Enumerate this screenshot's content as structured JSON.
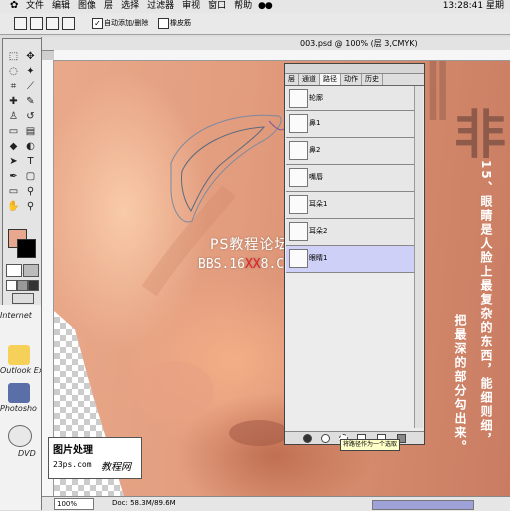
{
  "menubar": {
    "items": [
      "文件",
      "编辑",
      "图像",
      "层",
      "选择",
      "过滤器",
      "审视",
      "窗口",
      "帮助"
    ],
    "clock": "13:28:41 星期"
  },
  "options": {
    "auto_add_label": "自动添加/删除",
    "rubber_band_label": "橡皮筋"
  },
  "document": {
    "title": "003.psd @ 100% (层 3,CMYK)",
    "zoom": "100%",
    "doc_info": "Doc: 58.3M/89.6M"
  },
  "paths_panel": {
    "tabs": [
      "层",
      "通道",
      "路径",
      "动作",
      "历史"
    ],
    "active_tab": "路径",
    "rows": [
      "轮廓",
      "鼻1",
      "鼻2",
      "嘴唇",
      "耳朵1",
      "耳朵2",
      "眼睛1"
    ],
    "selected": "眼睛1",
    "tooltip": "将路径作为一个选取"
  },
  "watermark": {
    "line1": "PS教程论坛",
    "line2_before": "BBS.16",
    "line2_highlight": "XX",
    "line2_after": "8.COM"
  },
  "tutorial_text": {
    "col1": "15、眼睛是人脸上最复杂的东西，能细则细，",
    "col2": "把最深的部分勾出来。"
  },
  "corner_title": "非",
  "desktop_icons": [
    "Internet",
    "Outlook Ex",
    "Photosho",
    "DVD"
  ],
  "stamp": {
    "line1": "图片处理",
    "line2": "23ps.com",
    "line3": "教程网"
  },
  "colors": {
    "foreground": "#e8a890",
    "background": "#000000",
    "selected_row": "#cfd0f7",
    "watermark_red": "#e0222a"
  }
}
